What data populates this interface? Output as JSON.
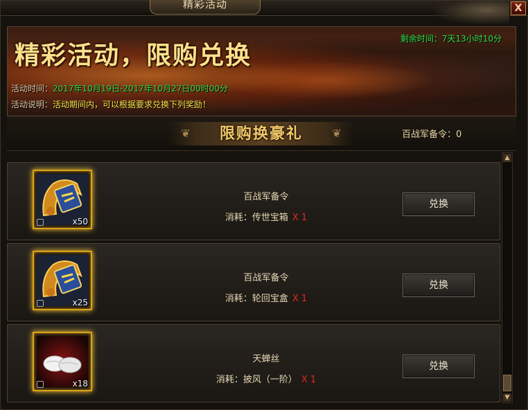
{
  "window": {
    "title": "精彩活动",
    "close_label": "X"
  },
  "banner": {
    "title": "精彩活动，限购兑换",
    "countdown": "剩余时间：7天13小时10分",
    "time_label": "活动时间：",
    "time_value": "2017年10月19日-2017年10月27日00时00分",
    "desc_label": "活动说明：",
    "desc_value": "活动期间内，可以根据要求兑换下列奖励！"
  },
  "section": {
    "title": "限购换豪礼",
    "counter": "百战军备令：0"
  },
  "items": [
    {
      "name": "百战军备令",
      "cost_label": "消耗：",
      "cost_item": "传世宝箱",
      "cost_mult": "X 1",
      "qty": "x50",
      "icon": "token-icon",
      "button": "兑换"
    },
    {
      "name": "百战军备令",
      "cost_label": "消耗：",
      "cost_item": "轮回宝盒",
      "cost_mult": "X 1",
      "qty": "x25",
      "icon": "token-icon",
      "button": "兑换"
    },
    {
      "name": "天蝉丝",
      "cost_label": "消耗：",
      "cost_item": "披风（一阶）",
      "cost_mult": "X 1",
      "qty": "x18",
      "icon": "silk-cocoon-icon",
      "button": "兑换"
    }
  ],
  "colors": {
    "countdown": "#2ee04a",
    "multiplier": "#e02a20",
    "icon_border": "#d9a41a"
  }
}
